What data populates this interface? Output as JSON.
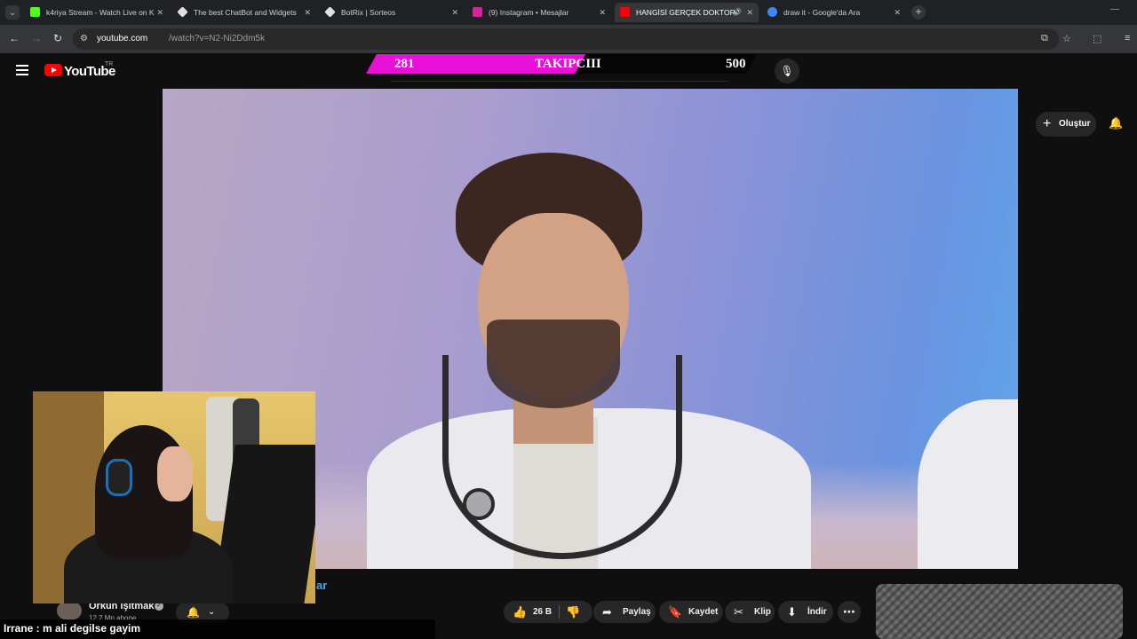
{
  "browser": {
    "tabs": [
      {
        "title": "k4riya Stream - Watch Live on K",
        "favicon_color": "#53fc18",
        "active": false
      },
      {
        "title": "The best ChatBot and Widgets",
        "favicon_color": "#e0e0e0",
        "active": false
      },
      {
        "title": "BotRix | Sorteos",
        "favicon_color": "#e0e0e0",
        "active": false
      },
      {
        "title": "(9) Instagram • Mesajlar",
        "favicon_color": "#d6249f",
        "active": false
      },
      {
        "title": "HANGİSİ GERÇEK DOKTOR?",
        "favicon_color": "#ff0000",
        "active": true
      },
      {
        "title": "draw it - Google'da Ara",
        "favicon_color": "#4285f4",
        "active": false
      }
    ],
    "url_host": "youtube.com",
    "url_path": "/watch?v=N2-Ni2Ddm5k"
  },
  "youtube": {
    "logo_text": "YouTube",
    "country": "TR",
    "create_label": "Oluştur"
  },
  "follower_goal": {
    "current": "281",
    "label": "TAKIPCIII",
    "target": "500",
    "progress_fraction": 0.562,
    "fill_color": "#e80fd6"
  },
  "video": {
    "title_tail": "ar",
    "channel_name": "Orkun Işıtmak",
    "subscribers": "12,2 Mn abone",
    "like_count": "26 B",
    "actions": {
      "share": "Paylaş",
      "save": "Kaydet",
      "clip": "Klip",
      "download": "İndir"
    }
  },
  "chat_overlay": {
    "text": "Irrane : m ali degilse gayim"
  },
  "colors": {
    "accent_red": "#ff0000",
    "link_blue": "#3ea6ff",
    "background": "#0f0f0f"
  }
}
